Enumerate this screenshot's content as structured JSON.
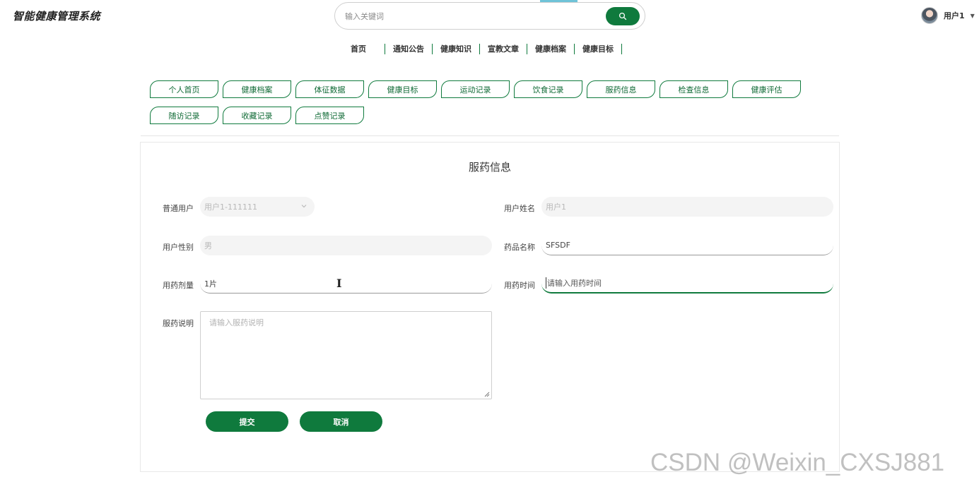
{
  "header": {
    "logo": "智能健康管理系统",
    "search_placeholder": "输入关键词",
    "user_name": "用户1"
  },
  "nav": [
    "首页",
    "通知公告",
    "健康知识",
    "宣教文章",
    "健康档案",
    "健康目标"
  ],
  "tabs": [
    "个人首页",
    "健康档案",
    "体征数据",
    "健康目标",
    "运动记录",
    "饮食记录",
    "服药信息",
    "检查信息",
    "健康评估",
    "随访记录",
    "收藏记录",
    "点赞记录"
  ],
  "form": {
    "title": "服药信息",
    "user_label": "普通用户",
    "user_value": "用户1-111111",
    "name_label": "用户姓名",
    "name_value": "用户1",
    "gender_label": "用户性别",
    "gender_value": "男",
    "drug_label": "药品名称",
    "drug_value": "SFSDF",
    "dose_label": "用药剂量",
    "dose_value": "1片",
    "time_label": "用药时间",
    "time_placeholder": "请输入用药时间",
    "desc_label": "服药说明",
    "desc_placeholder": "请输入服药说明",
    "submit_label": "提交",
    "cancel_label": "取消"
  },
  "watermark": "CSDN @Weixin_CXSJ881",
  "colors": {
    "primary": "#0f7a3d",
    "accent": "#6fc3d8"
  }
}
